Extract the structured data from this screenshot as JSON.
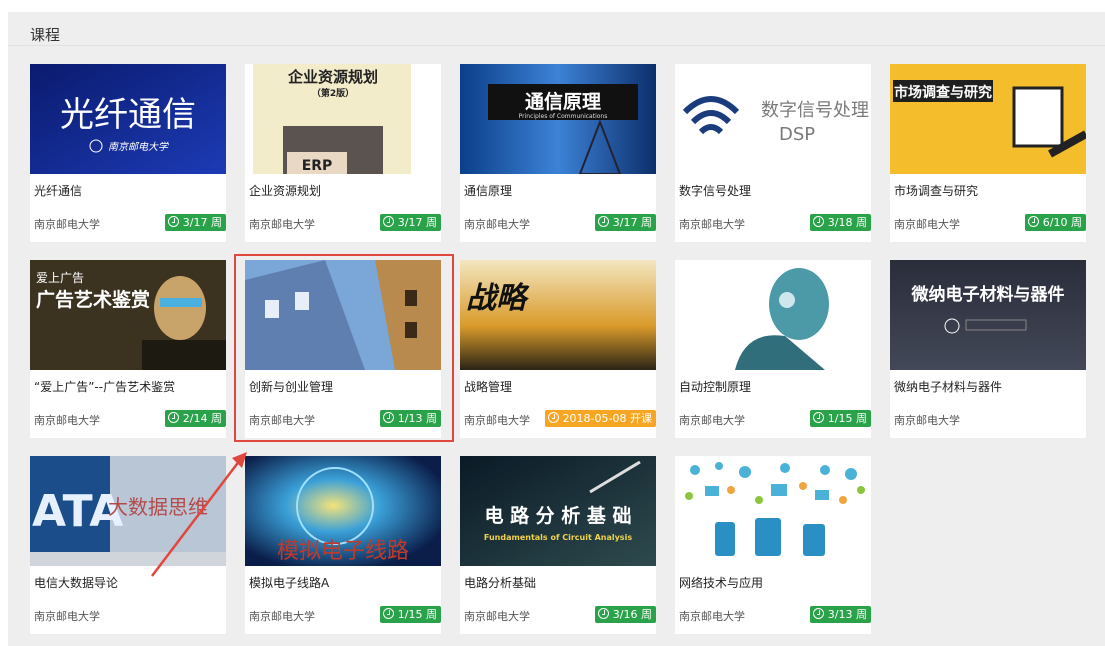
{
  "panel": {
    "title": "课程"
  },
  "courses": [
    {
      "name": "光纤通信",
      "school": "南京邮电大学",
      "week": "3/17 周",
      "thumb_text": "光纤通信",
      "thumb_sub": "南京邮电大学"
    },
    {
      "name": "企业资源规划",
      "school": "南京邮电大学",
      "week": "3/17 周",
      "thumb_text": "企业资源规划",
      "thumb_sub": "（第2版）",
      "thumb_tag": "ERP"
    },
    {
      "name": "通信原理",
      "school": "南京邮电大学",
      "week": "3/17 周",
      "thumb_text": "通信原理",
      "thumb_sub": "Principles of Communications"
    },
    {
      "name": "数字信号处理",
      "school": "南京邮电大学",
      "week": "3/18 周",
      "thumb_text": "数字信号处理",
      "thumb_sub": "DSP"
    },
    {
      "name": "市场调查与研究",
      "school": "南京邮电大学",
      "week": "6/10 周",
      "thumb_text": "市场调查与研究"
    },
    {
      "name": "“爱上广告”--广告艺术鉴赏",
      "school": "南京邮电大学",
      "week": "2/14 周",
      "thumb_text": "广告艺术鉴赏",
      "thumb_sub": "爱上广告"
    },
    {
      "name": "创新与创业管理",
      "school": "南京邮电大学",
      "week": "1/13 周"
    },
    {
      "name": "战略管理",
      "school": "南京邮电大学",
      "week": "2018-05-08 开课",
      "thumb_text": "战略"
    },
    {
      "name": "自动控制原理",
      "school": "南京邮电大学",
      "week": "1/15 周"
    },
    {
      "name": "微纳电子材料与器件",
      "school": "南京邮电大学",
      "week": "",
      "thumb_text": "微纳电子材料与器件"
    },
    {
      "name": "电信大数据导论",
      "school": "南京邮电大学",
      "week": "",
      "thumb_text": "大数据思维",
      "thumb_sub": "ATA"
    },
    {
      "name": "模拟电子线路A",
      "school": "南京邮电大学",
      "week": "1/15 周",
      "thumb_text": "模拟电子线路"
    },
    {
      "name": "电路分析基础",
      "school": "南京邮电大学",
      "week": "3/16 周",
      "thumb_text": "电 路 分 析 基 础",
      "thumb_sub": "Fundamentals of Circuit Analysis"
    },
    {
      "name": "网络技术与应用",
      "school": "南京邮电大学",
      "week": "3/13 周"
    }
  ],
  "colors": {
    "badge_green": "#2aa24a",
    "badge_orange": "#f6a623",
    "highlight": "#e0473f"
  }
}
